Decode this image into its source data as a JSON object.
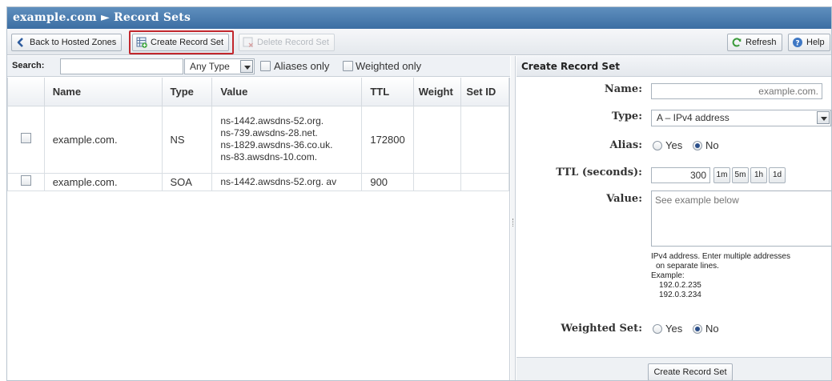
{
  "title": "example.com ► Record Sets",
  "toolbar": {
    "back_label": "Back to Hosted Zones",
    "create_label": "Create Record Set",
    "delete_label": "Delete Record Set",
    "refresh_label": "Refresh",
    "help_label": "Help"
  },
  "search": {
    "label": "Search:",
    "value": "",
    "type_selected": "Any Type",
    "aliases_only": "Aliases only",
    "weighted_only": "Weighted only"
  },
  "table": {
    "columns": [
      "Name",
      "Type",
      "Value",
      "TTL",
      "Weight",
      "Set ID"
    ],
    "rows": [
      {
        "name": "example.com.",
        "type": "NS",
        "value": [
          "ns-1442.awsdns-52.org.",
          "ns-739.awsdns-28.net.",
          "ns-1829.awsdns-36.co.uk.",
          "ns-83.awsdns-10.com."
        ],
        "ttl": "172800",
        "weight": "",
        "set_id": ""
      },
      {
        "name": "example.com.",
        "type": "SOA",
        "value": [
          "ns-1442.awsdns-52.org. av"
        ],
        "ttl": "900",
        "weight": "",
        "set_id": ""
      }
    ]
  },
  "panel": {
    "title": "Create Record Set",
    "name_label": "Name:",
    "name_placeholder": "example.com.",
    "type_label": "Type:",
    "type_value": "A – IPv4 address",
    "alias_label": "Alias:",
    "yes": "Yes",
    "no": "No",
    "ttl_label": "TTL (seconds):",
    "ttl_value": "300",
    "ttl_presets": [
      "1m",
      "5m",
      "1h",
      "1d"
    ],
    "value_label": "Value:",
    "value_placeholder": "See example below",
    "help_lines": [
      "IPv4 address. Enter multiple addresses",
      "on separate lines.",
      "Example:",
      "192.0.2.235",
      "192.0.3.234"
    ],
    "weighted_label": "Weighted Set:",
    "submit_label": "Create Record Set"
  },
  "colors": {
    "titlebar": "#4a7cb0",
    "highlight": "#c2272d",
    "radio_selected": "#2b4f8a"
  }
}
